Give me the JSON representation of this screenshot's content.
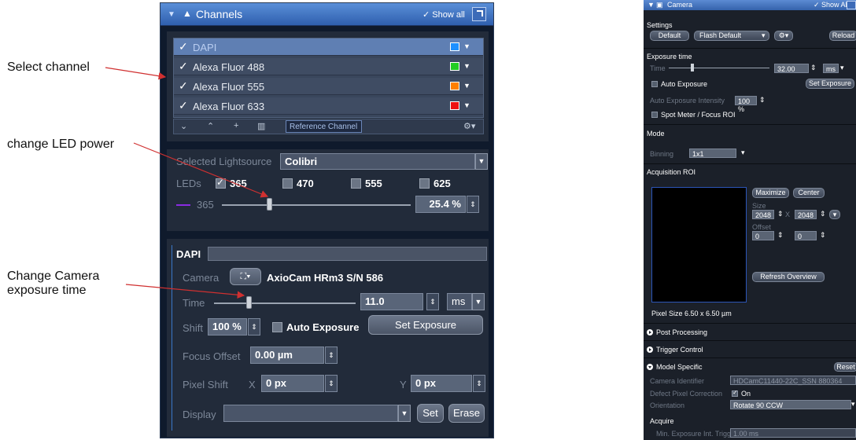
{
  "annotations": {
    "select_channel": "Select channel",
    "change_led": "change LED power",
    "change_camera_l1": "Change Camera",
    "change_camera_l2": "exposure time"
  },
  "left_panel": {
    "header": {
      "title": "Channels",
      "show_all": "✓ Show all"
    },
    "channels": [
      {
        "name": "DAPI",
        "checked": true,
        "color": "#1e90ff",
        "selected": true
      },
      {
        "name": "Alexa Fluor 488",
        "checked": true,
        "color": "#22cc22"
      },
      {
        "name": "Alexa Fluor 555",
        "checked": true,
        "color": "#ff7f00"
      },
      {
        "name": "Alexa Fluor 633",
        "checked": true,
        "color": "#ee1111"
      }
    ],
    "toolbar": {
      "reference_channel": "Reference Channel"
    },
    "lightsource": {
      "label": "Selected Lightsource",
      "value": "Colibri",
      "leds_label": "LEDs",
      "leds": [
        {
          "wl": "365",
          "checked": true
        },
        {
          "wl": "470",
          "checked": false
        },
        {
          "wl": "555",
          "checked": false
        },
        {
          "wl": "625",
          "checked": false
        }
      ],
      "slider_label": "365",
      "power": "25.4 %",
      "power_fraction": 0.25
    },
    "dapi": {
      "title": "DAPI",
      "camera_label": "Camera",
      "camera_name": "AxioCam HRm3 S/N 586",
      "time_label": "Time",
      "time_value": "11.0",
      "time_unit": "ms",
      "shift_label": "Shift",
      "shift_value": "100 %",
      "auto_exposure": "Auto Exposure",
      "set_exposure": "Set Exposure",
      "focus_offset_label": "Focus Offset",
      "focus_offset_value": "0.00 µm",
      "pixel_shift_label": "Pixel Shift",
      "x_label": "X",
      "x_value": "0 px",
      "y_label": "Y",
      "y_value": "0 px",
      "display_label": "Display",
      "set_btn": "Set",
      "erase_btn": "Erase"
    }
  },
  "right_panel": {
    "header": {
      "title": "Camera",
      "show_all": "✓ Show All"
    },
    "settings": {
      "title": "Settings",
      "default_btn": "Default",
      "preset_value": "Flash Default",
      "reload_btn": "Reload"
    },
    "exposure": {
      "title": "Exposure time",
      "time_label": "Time",
      "time_value": "32.00",
      "unit": "ms",
      "auto_exposure": "Auto Exposure",
      "set_exposure": "Set Exposure",
      "intensity_label": "Auto Exposure Intensity",
      "intensity_value": "100 %",
      "spot_meter": "Spot Meter / Focus ROI"
    },
    "mode": {
      "title": "Mode",
      "binning_label": "Binning",
      "binning_value": "1x1"
    },
    "roi": {
      "title": "Acquisition ROI",
      "maximize": "Maximize",
      "center": "Center",
      "size_label": "Size",
      "size_w": "2048",
      "x_sep": "X",
      "size_h": "2048",
      "offset_label": "Offset",
      "offset_x": "0",
      "offset_y": "0",
      "refresh": "Refresh Overview",
      "pixel_size": "Pixel Size  6.50 x 6.50 µm"
    },
    "post_processing": "Post Processing",
    "trigger_control": "Trigger Control",
    "model_specific": {
      "title": "Model Specific",
      "reset": "Reset",
      "camera_id_label": "Camera Identifier",
      "camera_id_value": "HDCamC11440-22C_SSN 880364",
      "defect_label": "Defect Pixel Correction",
      "defect_value": "On",
      "orientation_label": "Orientation",
      "orientation_value": "Rotate 90 CCW"
    },
    "acquire": {
      "title": "Acquire",
      "min_exp_label": "Min. Exposure Int. Trigger",
      "min_exp_value": "1.00 ms"
    }
  },
  "colors": {
    "accent": "#3a6fc4",
    "arrow": "#d03030"
  }
}
